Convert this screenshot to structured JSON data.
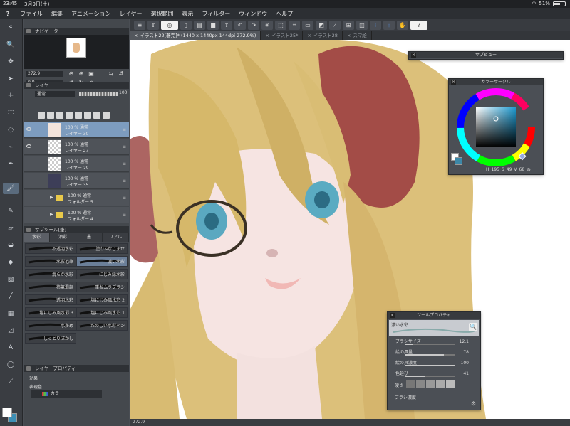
{
  "status_bar": {
    "time": "23:45",
    "date": "3月9日(土)",
    "battery": "51%"
  },
  "menu": {
    "items": [
      "ファイル",
      "編集",
      "アニメーション",
      "レイヤー",
      "選択範囲",
      "表示",
      "フィルター",
      "ウィンドウ",
      "ヘルプ"
    ]
  },
  "tabs": [
    {
      "label": "イラスト22[著完]* (1440 x 1440px 144dpi 272.9%)",
      "active": true
    },
    {
      "label": "イラスト25*",
      "active": false
    },
    {
      "label": "イラスト28",
      "active": false
    },
    {
      "label": "スマ絵",
      "active": false
    }
  ],
  "navigator": {
    "title": "ナビゲーター",
    "zoom": "272.9",
    "rotation": "0.0"
  },
  "layers": {
    "title": "レイヤー",
    "blend_mode": "通常",
    "opacity": "100",
    "items": [
      {
        "opacity": "100 % 通常",
        "name": "レイヤー 30",
        "selected": true,
        "thumb": "face",
        "eye": true
      },
      {
        "opacity": "100 % 通常",
        "name": "レイヤー 27",
        "selected": false,
        "thumb": "blank",
        "eye": true
      },
      {
        "opacity": "100 % 通常",
        "name": "レイヤー 29",
        "selected": false,
        "thumb": "blank",
        "eye": false
      },
      {
        "opacity": "100 % 通常",
        "name": "レイヤー 35",
        "selected": false,
        "thumb": "dark",
        "eye": false
      },
      {
        "opacity": "100 % 通常",
        "name": "フォルダー 5",
        "selected": false,
        "thumb": "folder",
        "eye": false
      },
      {
        "opacity": "100 % 通常",
        "name": "フォルダー 4",
        "selected": false,
        "thumb": "folder",
        "eye": false
      }
    ]
  },
  "subtool": {
    "title": "サブツール[筆]",
    "tabs": [
      "水彩",
      "油彩",
      "墨",
      "リアル"
    ],
    "brushes_left": [
      "不透明水彩",
      "水彩毛筆",
      "滑らか水彩",
      "柿筆混調",
      "透明水彩",
      "塩にじみ風水彩 3",
      "水多め",
      "しっとりぼかし"
    ],
    "brushes_right": [
      "塗り&なじませ",
      "濃い水彩",
      "にじみ縁水彩",
      "重ねムラブラシ",
      "塩にじみ風水彩 2",
      "塩にじみ風水彩 1",
      "たのしい水彩ペン",
      ""
    ],
    "selected_right_index": 1
  },
  "layer_property": {
    "title": "レイヤープロパティ",
    "effect_label": "効果",
    "express_label": "表現色",
    "color_value": "カラー"
  },
  "subview": {
    "title": "サブビュー"
  },
  "color_circle": {
    "title": "カラーサークル",
    "h": "195",
    "s": "49",
    "v": "68",
    "selected_color": "#3c88a8"
  },
  "tool_property": {
    "title": "ツールプロパティ",
    "brush_name": "濃い水彩",
    "rows": [
      {
        "label": "ブラシサイズ",
        "value": "12.1",
        "fill": 0.17
      },
      {
        "label": "絵の具量",
        "value": "78",
        "fill": 0.78
      },
      {
        "label": "絵の具濃度",
        "value": "100",
        "fill": 1.0
      },
      {
        "label": "色延び",
        "value": "41",
        "fill": 0.41
      }
    ],
    "hardness_label": "硬さ",
    "density_label": "ブラシ濃度"
  },
  "canvas_status": {
    "zoom": "272.9"
  }
}
